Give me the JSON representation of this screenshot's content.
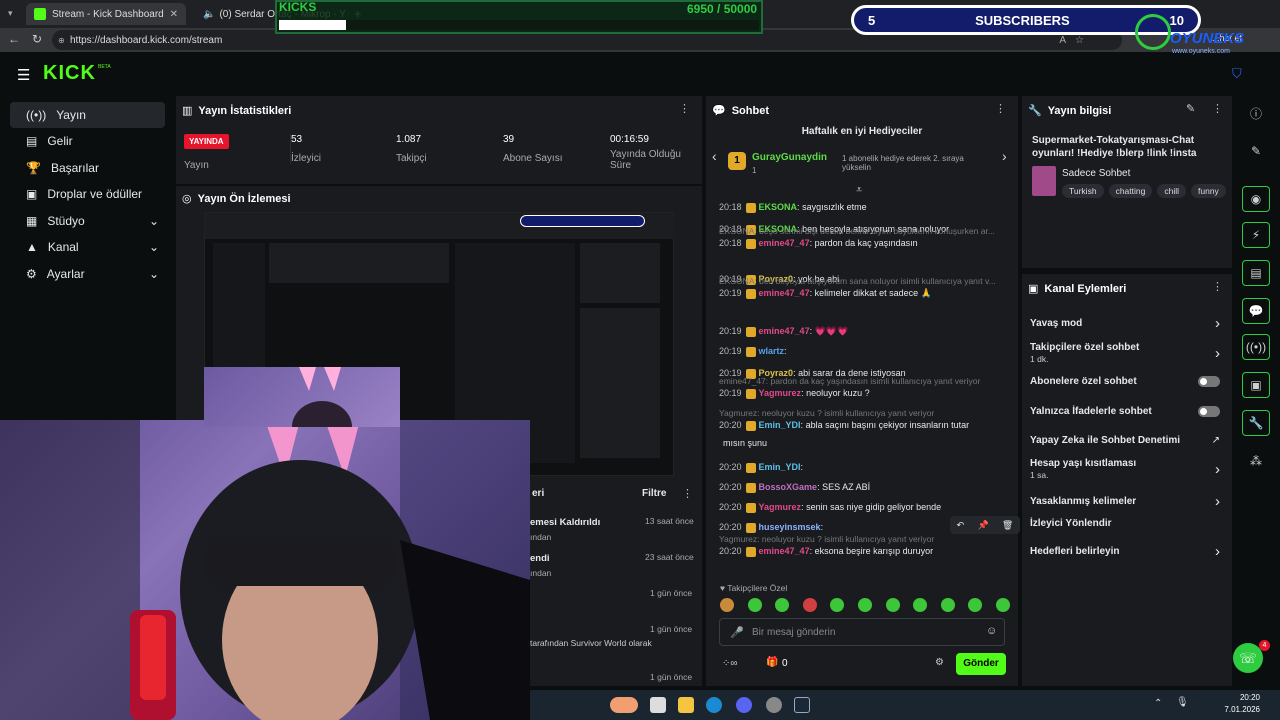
{
  "browser": {
    "tabs": [
      {
        "title": "Stream - Kick Dashboard"
      },
      {
        "title": "(0) Serdar Ortaç - Mikrop - Yo"
      }
    ],
    "url": "https://dashboard.kick.com/stream",
    "addr_right": "...het et"
  },
  "overlays": {
    "kicks_label": "KICKS",
    "kicks_progress": "6950 / 50000",
    "kicks_fraction": 0.139,
    "subs_left": "5",
    "subs_label": "SUBSCRIBERS",
    "subs_right": "10",
    "brand_badge": "OYUNEKS",
    "brand_site": "www.oyuneks.com"
  },
  "nav": {
    "logo": "KICK",
    "logo_beta": "BETA",
    "items": [
      {
        "label": "Yayın",
        "icon": "broadcast-icon"
      },
      {
        "label": "Gelir",
        "icon": "revenue-icon"
      },
      {
        "label": "Başarılar",
        "icon": "trophy-icon"
      },
      {
        "label": "Droplar ve ödüller",
        "icon": "gift-icon"
      },
      {
        "label": "Stüdyo",
        "icon": "studio-icon"
      },
      {
        "label": "Kanal",
        "icon": "channel-icon"
      },
      {
        "label": "Ayarlar",
        "icon": "gear-icon"
      }
    ]
  },
  "stats": {
    "title": "Yayın İstatistikleri",
    "live_badge": "YAYINDA",
    "live_label": "Yayın",
    "items": [
      {
        "value": "53",
        "label": "İzleyici"
      },
      {
        "value": "1.087",
        "label": "Takipçi"
      },
      {
        "value": "39",
        "label": "Abone Sayısı"
      },
      {
        "value": "00:16:59",
        "label": "Yayında Olduğu Süre"
      }
    ]
  },
  "preview": {
    "title": "Yayın Ön İzlemesi"
  },
  "activity": {
    "filter_label": "Filtre",
    "rows": [
      {
        "text": "emesi Kaldırıldı",
        "sub": "ından",
        "time": "13 saat önce"
      },
      {
        "text": "endi",
        "sub": "ından",
        "time": "23 saat önce"
      },
      {
        "text": "",
        "sub": "",
        "time": "1 gün önce"
      },
      {
        "text": "tarafından Survivor World olarak",
        "sub": "",
        "time": "1 gün önce"
      },
      {
        "text": "",
        "sub": "",
        "time": "1 gün önce"
      }
    ]
  },
  "chat": {
    "title": "Sohbet",
    "gifters_title": "Haftalık en iyi Hediyeciler",
    "gifter_rank": "1",
    "gifter_name": "GurayGunaydin",
    "gifter_count": "1",
    "gifter_note": "1 abonelik hediye ederek 2. sıraya yükselin",
    "messages": [
      {
        "reply": "",
        "time": "20:18",
        "user": "EKSONA",
        "color": "#5ddb46",
        "msg": "saygısızlık etme"
      },
      {
        "reply": "",
        "time": "20:18",
        "user": "EKSONA",
        "color": "#5ddb46",
        "msg": "ben beşoyla atışıyorum sana noluyor"
      },
      {
        "reply": "EKSONA: beşo senmi bişi dersin benmi diyim büyüklerin konuşurken ar...",
        "time": "20:18",
        "user": "emine47_47",
        "color": "#e04a8a",
        "msg": "pardon da kaç yaşındasın"
      },
      {
        "reply": "",
        "time": "20:19",
        "user": "Poyraz0",
        "color": "#d8c24a",
        "msg": "yok be abi"
      },
      {
        "reply": "EKSONA: ben beşoyla atışıyorum sana noluyor isimli kullanıcıya yanıt v...",
        "time": "20:19",
        "user": "emine47_47",
        "color": "#e04a8a",
        "msg": "kelimeler dikkat et sadece 🙏"
      },
      {
        "reply": "",
        "time": "20:19",
        "user": "emine47_47",
        "color": "#e04a8a",
        "msg": "💗💗💗"
      },
      {
        "reply": "",
        "time": "20:19",
        "user": "wlartz",
        "color": "#5aa0e8",
        "msg": ""
      },
      {
        "reply": "",
        "time": "20:19",
        "user": "Poyraz0",
        "color": "#d8c24a",
        "msg": "abi sarar da dene istiyosan"
      },
      {
        "reply": "emine47_47: pardon da kaç yaşındasın isimli kullanıcıya yanıt veriyor",
        "time": "20:19",
        "user": "Yagmurez",
        "color": "#e04a8a",
        "msg": "neoluyor kuzu ?"
      },
      {
        "reply": "Yagmurez: neoluyor kuzu ? isimli kullanıcıya yanıt veriyor",
        "time": "20:20",
        "user": "Emin_YDI",
        "color": "#5dc0e8",
        "msg": "abla saçını başını çekiyor insanların tutar"
      },
      {
        "reply": "",
        "time": "",
        "user": "",
        "color": "#e8e8e8",
        "msg": "mısın şunu"
      },
      {
        "reply": "",
        "time": "20:20",
        "user": "Emin_YDI",
        "color": "#5dc0e8",
        "msg": ""
      },
      {
        "reply": "",
        "time": "20:20",
        "user": "BossoXGame",
        "color": "#c070c0",
        "msg": "SES AZ ABİ"
      },
      {
        "reply": "",
        "time": "20:20",
        "user": "Yagmurez",
        "color": "#e04a8a",
        "msg": "senin sas niye gidip geliyor bende"
      },
      {
        "reply": "",
        "time": "20:20",
        "user": "huseyinsmsek",
        "color": "#8ab0ff",
        "msg": ""
      },
      {
        "reply": "Yagmurez: neoluyor kuzu ? isimli kullanıcıya yanıt veriyor",
        "time": "20:20",
        "user": "emine47_47",
        "color": "#e04a8a",
        "msg": "eksona beşire karışıp duruyor"
      }
    ],
    "followers_only": "Takipçilere Özel",
    "input_placeholder": "Bir mesaj gönderin",
    "send_label": "Gönder",
    "footer_count": "0"
  },
  "stream_info": {
    "title": "Yayın bilgisi",
    "stream_title": "Supermarket-Tokatyarışması-Chat oyunları! !Hediye !blerp !link !insta",
    "category": "Sadece Sohbet",
    "tags": [
      "Turkish",
      "chatting",
      "chill",
      "funny"
    ]
  },
  "channel_actions": {
    "title": "Kanal Eylemleri",
    "items": [
      {
        "label": "Yavaş mod",
        "sub": "",
        "control": "chevron"
      },
      {
        "label": "Takipçilere özel sohbet",
        "sub": "1 dk.",
        "control": "chevron"
      },
      {
        "label": "Abonelere özel sohbet",
        "sub": "",
        "control": "toggle"
      },
      {
        "label": "Yalnızca İfadelerle sohbet",
        "sub": "",
        "control": "toggle"
      },
      {
        "label": "Yapay Zeka ile Sohbet Denetimi",
        "sub": "",
        "control": "external"
      },
      {
        "label": "Hesap yaşı kısıtlaması",
        "sub": "1 sa.",
        "control": "chevron"
      },
      {
        "label": "Yasaklanmış kelimeler",
        "sub": "",
        "control": "chevron"
      },
      {
        "label": "İzleyici Yönlendir",
        "sub": "",
        "control": "none"
      },
      {
        "label": "Hedefleri belirleyin",
        "sub": "",
        "control": "chevron"
      }
    ]
  },
  "taskbar": {
    "time": "20:20",
    "date": "7.01.2026",
    "notif": "4"
  },
  "colors": {
    "kick_green": "#53fc18",
    "panel": "#191b1f",
    "bg": "#0b0e0f",
    "live_red": "#e5162c"
  }
}
